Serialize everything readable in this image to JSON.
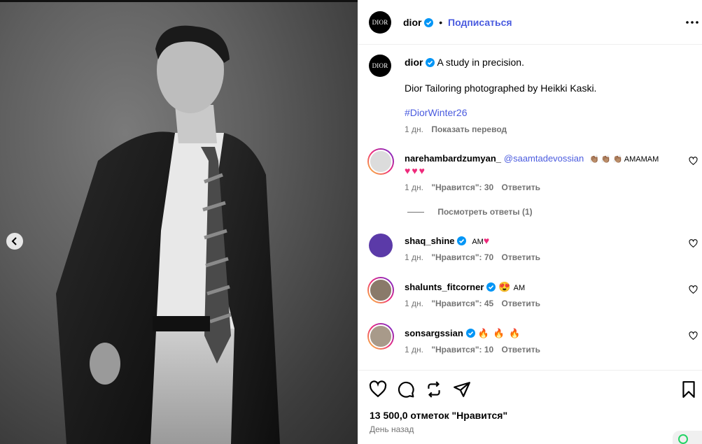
{
  "post": {
    "author": "dior",
    "avatar_text": "DIOR",
    "follow_label": "Подписаться",
    "separator": "•"
  },
  "caption": {
    "author": "dior",
    "line1": "A study in precision.",
    "line2": "Dior Tailoring photographed by Heikki Kaski.",
    "hashtag": "#DiorWinter26",
    "age": "1 дн.",
    "translate_label": "Показать перевод"
  },
  "comments": [
    {
      "username": "narehambardzumyan_",
      "mention": "@saamtadevossian",
      "text": "👏🏽 👏🏽 👏🏽 AMAMAM",
      "text2": "♥♥♥",
      "age": "1 дн.",
      "likes": "\"Нравится\": 30",
      "reply": "Ответить",
      "verified": false
    },
    {
      "username": "shaq_shine",
      "text": "AM",
      "emoji": "♥",
      "age": "1 дн.",
      "likes": "\"Нравится\": 70",
      "reply": "Ответить",
      "verified": true
    },
    {
      "username": "shalunts_fitcorner",
      "text": "AM",
      "emoji": "😍",
      "age": "1 дн.",
      "likes": "\"Нравится\": 45",
      "reply": "Ответить",
      "verified": true
    },
    {
      "username": "sonsargssian",
      "text": "🔥🔥🔥",
      "age": "1 дн.",
      "likes": "\"Нравится\": 10",
      "reply": "Ответить",
      "verified": true
    }
  ],
  "view_replies": "Посмотреть ответы (1)",
  "footer": {
    "likes": "13 500,0 отметок \"Нравится\"",
    "date": "День назад"
  },
  "colors": {
    "accent": "#4a5bdf",
    "verified": "#0095f6",
    "muted": "#737373"
  }
}
